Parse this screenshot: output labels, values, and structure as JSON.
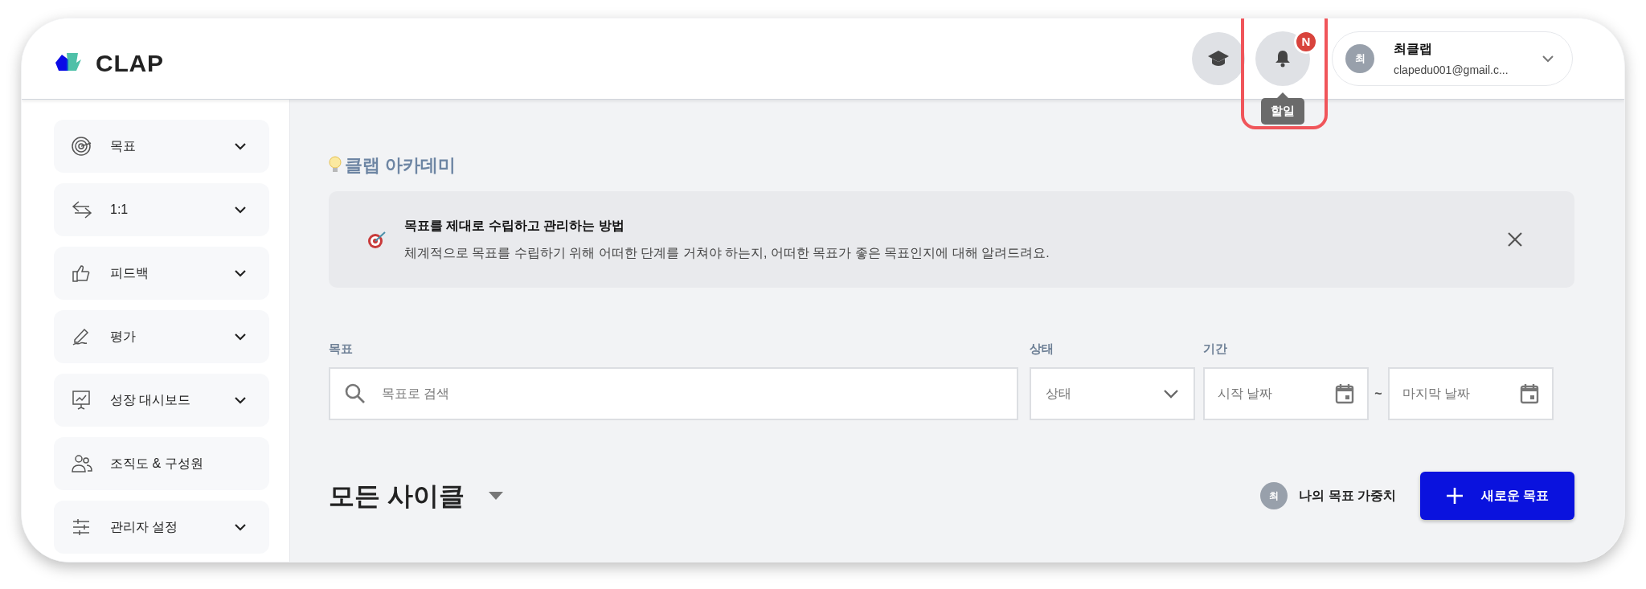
{
  "logo": {
    "text": "CLAP"
  },
  "header": {
    "academy_button": {
      "kind": "academy"
    },
    "notification_button": {
      "badge": "N",
      "tooltip": "할일",
      "highlighted": true
    },
    "user": {
      "avatar": "최",
      "name": "최클랩",
      "email": "clapedu001@gmail.c..."
    }
  },
  "sidebar": {
    "items": [
      {
        "label": "목표",
        "kind": "target",
        "expandable": true
      },
      {
        "label": "1:1",
        "kind": "exchange",
        "expandable": true
      },
      {
        "label": "피드백",
        "kind": "thumb",
        "expandable": true
      },
      {
        "label": "평가",
        "kind": "pen",
        "expandable": true
      },
      {
        "label": "성장 대시보드",
        "kind": "board",
        "expandable": true
      },
      {
        "label": "조직도 & 구성원",
        "kind": "people",
        "expandable": false
      },
      {
        "label": "관리자 설정",
        "kind": "sliders",
        "expandable": true
      }
    ]
  },
  "academy": {
    "title": "클랩 아카데미",
    "card": {
      "title": "목표를 제대로 수립하고 관리하는 방법",
      "description": "체계적으로 목표를 수립하기 위해 어떠한 단계를 거쳐야 하는지, 어떠한 목표가 좋은 목표인지에 대해 알려드려요."
    }
  },
  "filters": {
    "goal_label": "목표",
    "search_placeholder": "목표로 검색",
    "status_label": "상태",
    "status_placeholder": "상태",
    "period_label": "기간",
    "start_placeholder": "시작 날짜",
    "separator": "~",
    "end_placeholder": "마지막 날짜"
  },
  "cycle": {
    "title": "모든 사이클"
  },
  "weight": {
    "avatar": "최",
    "label": "나의 목표 가중치"
  },
  "new_goal_button": {
    "label": "새로운 목표"
  }
}
